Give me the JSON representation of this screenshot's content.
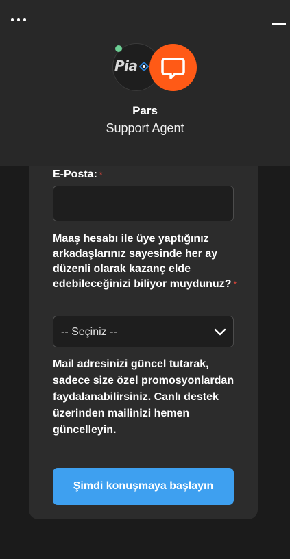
{
  "header": {
    "menu_icon": "more-horizontal-icon",
    "minimize_icon": "minimize-icon",
    "agent_name": "Pars",
    "agent_role": "Support Agent",
    "logo_text": "Pia",
    "chat_icon": "chat-bubble-icon",
    "status_color": "#6ccf94",
    "chat_color": "#ff5a16"
  },
  "form": {
    "email_label": "E-Posta:",
    "email_value": "",
    "required_mark": "*",
    "question_label": "Maaş hesabı ile üye yaptığınız arkadaşlarınız sayesinde her ay düzenli olarak kazanç elde edebileceğinizi biliyor muydunuz?",
    "select_value": "-- Seçiniz --",
    "info_text": "Mail adresinizi güncel tutarak, sadece size özel promosyonlardan faydalanabilirsiniz. Canlı destek üzerinden mailinizi hemen güncelleyin.",
    "submit_label": "Şimdi konuşmaya başlayın",
    "accent_color": "#3ea0f0"
  }
}
